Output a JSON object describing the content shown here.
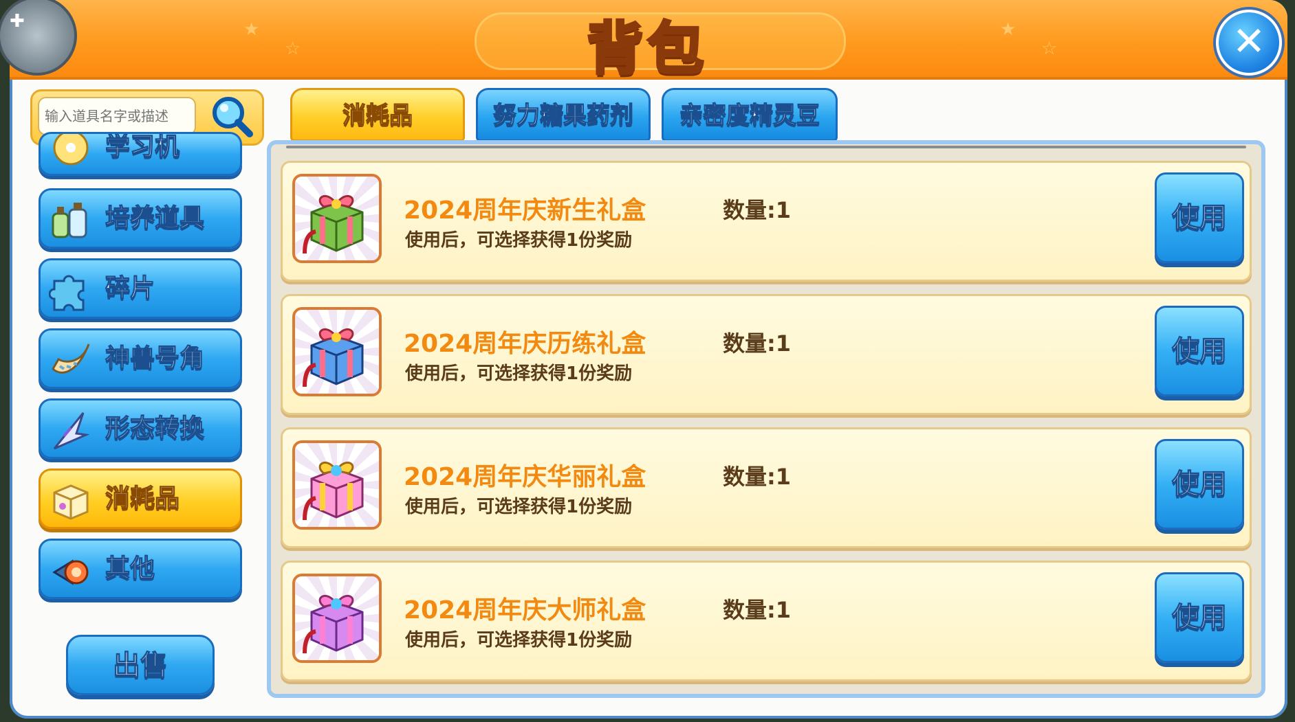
{
  "header": {
    "title": "背包",
    "close_icon": "close-icon"
  },
  "search": {
    "placeholder": "输入道具名字或描述",
    "icon": "magnifier-icon"
  },
  "sidebar": {
    "items": [
      {
        "label": "学习机",
        "icon": "disc-icon",
        "active": false
      },
      {
        "label": "培养道具",
        "icon": "bottles-icon",
        "active": false
      },
      {
        "label": "碎片",
        "icon": "puzzle-icon",
        "active": false
      },
      {
        "label": "神兽号角",
        "icon": "horn-icon",
        "active": false
      },
      {
        "label": "形态转换",
        "icon": "blade-icon",
        "active": false
      },
      {
        "label": "消耗品",
        "icon": "box-icon",
        "active": true
      },
      {
        "label": "其他",
        "icon": "gem-icon",
        "active": false
      }
    ],
    "sell_label": "出售"
  },
  "tabs": [
    {
      "label": "消耗品",
      "active": true
    },
    {
      "label": "努力糖果药剂",
      "active": false
    },
    {
      "label": "亲密度精灵豆",
      "active": false
    }
  ],
  "items": [
    {
      "name": "2024周年庆新生礼盒",
      "desc": "使用后，可选择获得1份奖励",
      "qty": "数量:1",
      "use_label": "使用",
      "box_color": "#7ec44a",
      "ribbon_color": "#ff6d8a"
    },
    {
      "name": "2024周年庆历练礼盒",
      "desc": "使用后，可选择获得1份奖励",
      "qty": "数量:1",
      "use_label": "使用",
      "box_color": "#5aa0ee",
      "ribbon_color": "#ff6d8a"
    },
    {
      "name": "2024周年庆华丽礼盒",
      "desc": "使用后，可选择获得1份奖励",
      "qty": "数量:1",
      "use_label": "使用",
      "box_color": "#ff9ed6",
      "ribbon_color": "#ffd23a"
    },
    {
      "name": "2024周年庆大师礼盒",
      "desc": "使用后，可选择获得1份奖励",
      "qty": "数量:1",
      "use_label": "使用",
      "box_color": "#d68af0",
      "ribbon_color": "#ff7fd2"
    }
  ],
  "colors": {
    "accent_orange": "#ff9a1e",
    "button_blue": "#2fa8f2",
    "active_yellow": "#ffcf24",
    "item_name": "#f28a12"
  }
}
